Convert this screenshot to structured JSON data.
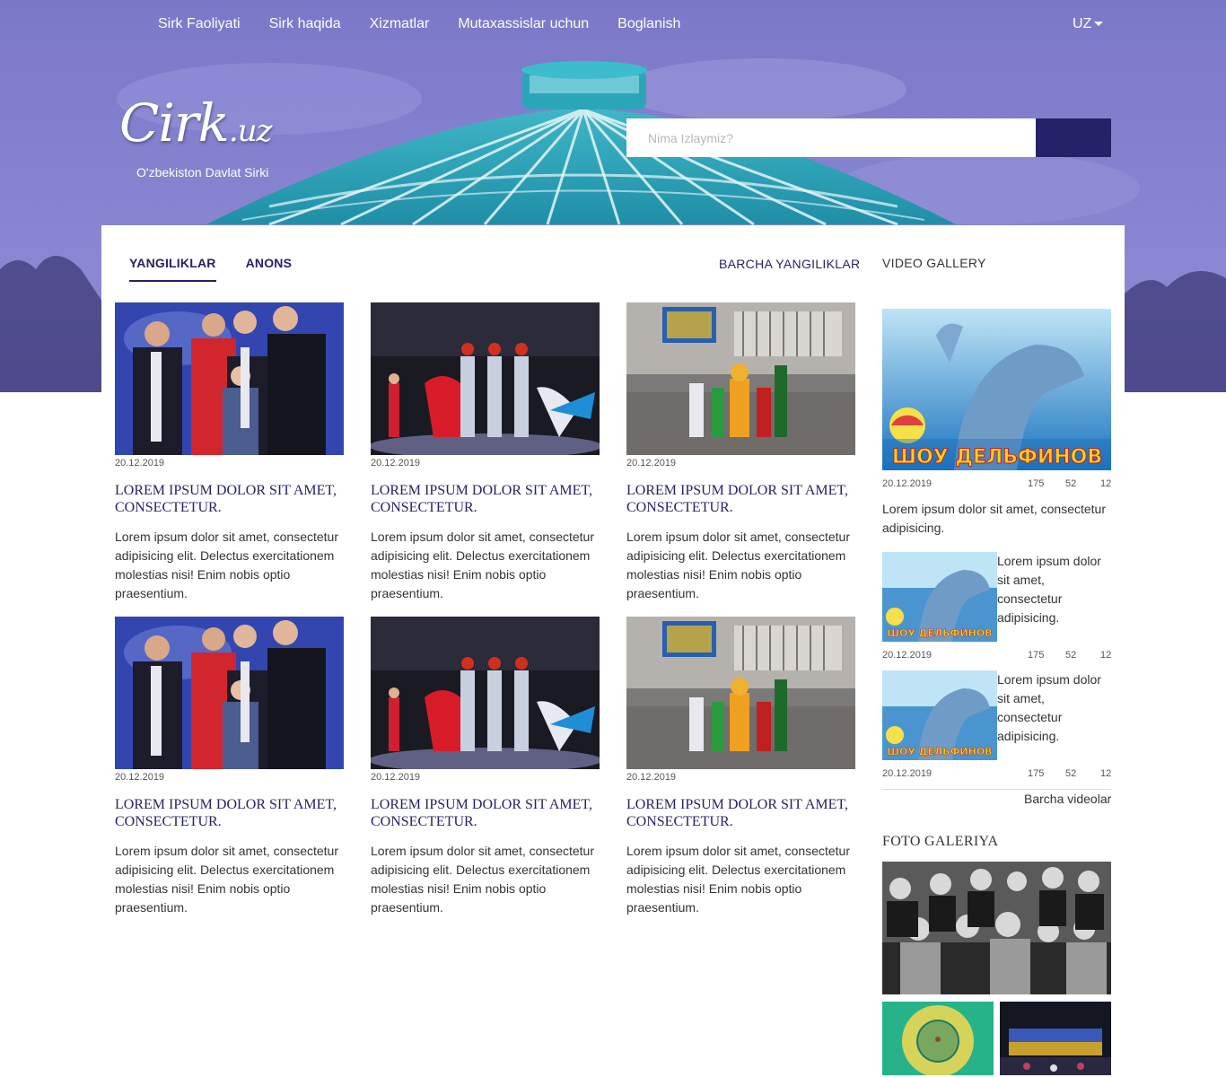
{
  "nav": {
    "items": [
      "Sirk Faoliyati",
      "Sirk haqida",
      "Xizmatlar",
      "Mutaxassislar uchun",
      "Boglanish"
    ],
    "language": "UZ"
  },
  "logo": {
    "text": "Cirk",
    "suffix": ".uz",
    "subtitle": "O'zbekiston Davlat Sirki"
  },
  "search": {
    "placeholder": "Nima Izlaymiz?",
    "button_color": "#25226a"
  },
  "tabs": {
    "news": "YANGILIKLAR",
    "announce": "ANONS",
    "all_news": "BARCHA YANGILIKLAR"
  },
  "news": [
    {
      "date": "20.12.2019",
      "title": "LOREM IPSUM DOLOR SIT AMET, CONSECTETUR.",
      "desc": "Lorem ipsum dolor sit amet, consectetur adipisicing elit. Delectus exercitationem molestias nisi! Enim nobis optio praesentium.",
      "image": "award-group-photo"
    },
    {
      "date": "20.12.2019",
      "title": "LOREM IPSUM DOLOR SIT AMET, CONSECTETUR.",
      "desc": "Lorem ipsum dolor sit amet, consectetur adipisicing elit. Delectus exercitationem molestias nisi! Enim nobis optio praesentium.",
      "image": "circus-arena-performers"
    },
    {
      "date": "20.12.2019",
      "title": "LOREM IPSUM DOLOR SIT AMET, CONSECTETUR.",
      "desc": "Lorem ipsum dolor sit amet, consectetur adipisicing elit. Delectus exercitationem molestias nisi! Enim nobis optio praesentium.",
      "image": "costume-characters-outside"
    },
    {
      "date": "20.12.2019",
      "title": "LOREM IPSUM DOLOR SIT AMET, CONSECTETUR.",
      "desc": "Lorem ipsum dolor sit amet, consectetur adipisicing elit. Delectus exercitationem molestias nisi! Enim nobis optio praesentium.",
      "image": "award-group-photo"
    },
    {
      "date": "20.12.2019",
      "title": "LOREM IPSUM DOLOR SIT AMET, CONSECTETUR.",
      "desc": "Lorem ipsum dolor sit amet, consectetur adipisicing elit. Delectus exercitationem molestias nisi! Enim nobis optio praesentium.",
      "image": "circus-arena-performers"
    },
    {
      "date": "20.12.2019",
      "title": "LOREM IPSUM DOLOR SIT AMET, CONSECTETUR.",
      "desc": "Lorem ipsum dolor sit amet, consectetur adipisicing elit. Delectus exercitationem molestias nisi! Enim nobis optio praesentium.",
      "image": "costume-characters-outside"
    }
  ],
  "video_gallery": {
    "title": "VIDEO GALLERY",
    "main": {
      "date": "20.12.2019",
      "views": "175",
      "likes": "52",
      "comments": "12",
      "desc": "Lorem ipsum dolor sit amet, consectetur adipisicing.",
      "poster_text": "ШОУ ДЕЛЬФИНОВ"
    },
    "items": [
      {
        "date": "20.12.2019",
        "views": "175",
        "likes": "52",
        "comments": "12",
        "desc": "Lorem ipsum dolor sit amet, consectetur adipisicing.",
        "poster_text": "ШОУ ДЕЛЬФИНОВ"
      },
      {
        "date": "20.12.2019",
        "views": "175",
        "likes": "52",
        "comments": "12",
        "desc": "Lorem ipsum dolor sit amet, consectetur adipisicing.",
        "poster_text": "ШОУ ДЕЛЬФИНОВ"
      }
    ],
    "all_label": "Barcha videolar"
  },
  "photo_gallery": {
    "title": "FOTO GALERIYA"
  },
  "colors": {
    "brand": "#25226a",
    "hero": "#8482cf"
  }
}
